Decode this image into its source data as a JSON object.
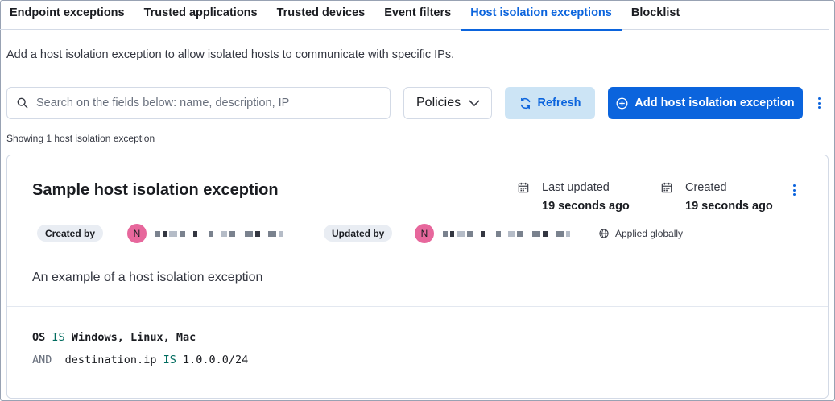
{
  "tabs": [
    {
      "label": "Endpoint exceptions",
      "active": false
    },
    {
      "label": "Trusted applications",
      "active": false
    },
    {
      "label": "Trusted devices",
      "active": false
    },
    {
      "label": "Event filters",
      "active": false
    },
    {
      "label": "Host isolation exceptions",
      "active": true
    },
    {
      "label": "Blocklist",
      "active": false
    }
  ],
  "description": "Add a host isolation exception to allow isolated hosts to communicate with specific IPs.",
  "toolbar": {
    "search_placeholder": "Search on the fields below: name, description, IP",
    "search_value": "",
    "policies_label": "Policies",
    "refresh_label": "Refresh",
    "add_label": "Add host isolation exception"
  },
  "showing_text": "Showing 1 host isolation exception",
  "card": {
    "title": "Sample host isolation exception",
    "last_updated_label": "Last updated",
    "last_updated_value": "19 seconds ago",
    "created_label": "Created",
    "created_value": "19 seconds ago",
    "created_by_label": "Created by",
    "created_by_initial": "N",
    "updated_by_label": "Updated by",
    "updated_by_initial": "N",
    "applied_label": "Applied globally",
    "description": "An example of a host isolation exception",
    "conditions": {
      "line1_field": "OS",
      "line1_op": "IS",
      "line1_value": "Windows, Linux, Mac",
      "line2_join": "AND",
      "line2_field": "destination.ip",
      "line2_op": "IS",
      "line2_value": "1.0.0.0/24"
    }
  },
  "colors": {
    "accent": "#0b64dd",
    "avatar": "#e7679c",
    "keyword": "#006b5e"
  },
  "icons": [
    "search-icon",
    "chevron-down-icon",
    "refresh-icon",
    "plus-circle-icon",
    "kebab-icon",
    "calendar-icon",
    "globe-icon"
  ]
}
